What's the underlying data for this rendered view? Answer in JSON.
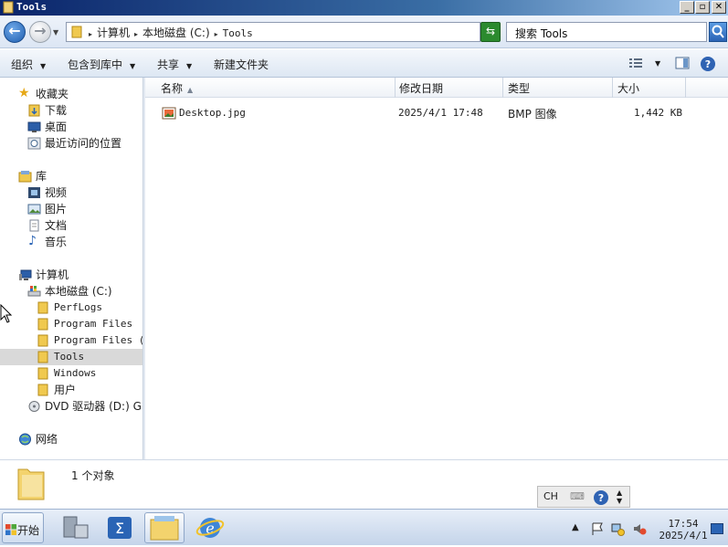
{
  "window": {
    "title": "Tools"
  },
  "address": {
    "crumbs": [
      "计算机",
      "本地磁盘 (C:)",
      "Tools"
    ]
  },
  "search": {
    "placeholder": "搜索 Tools"
  },
  "toolbar": {
    "organize": "组织",
    "include_library": "包含到库中",
    "share": "共享",
    "new_folder": "新建文件夹"
  },
  "nav": {
    "favorites": "收藏夹",
    "downloads": "下载",
    "desktop": "桌面",
    "recent": "最近访问的位置",
    "libraries": "库",
    "videos": "视频",
    "pictures": "图片",
    "documents": "文档",
    "music": "音乐",
    "computer": "计算机",
    "local_disk": "本地磁盘 (C:)",
    "perflogs": "PerfLogs",
    "program_files": "Program Files",
    "program_files_x86": "Program Files (x",
    "tools": "Tools",
    "windows": "Windows",
    "users": "用户",
    "dvd": "DVD 驱动器 (D:) GF",
    "network": "网络"
  },
  "columns": {
    "name": "名称",
    "modified": "修改日期",
    "type": "类型",
    "size": "大小"
  },
  "files": [
    {
      "name": "Desktop.jpg",
      "modified": "2025/4/1 17:48",
      "type": "BMP 图像",
      "size": "1,442 KB"
    }
  ],
  "details": {
    "count": "1 个对象"
  },
  "langbar": {
    "lang": "CH"
  },
  "taskbar": {
    "start": "开始",
    "time": "17:54",
    "date": "2025/4/1"
  },
  "colors": {
    "accent": "#2b6cb8",
    "selection": "#d9d9d9",
    "folder": "#e8c25a"
  }
}
